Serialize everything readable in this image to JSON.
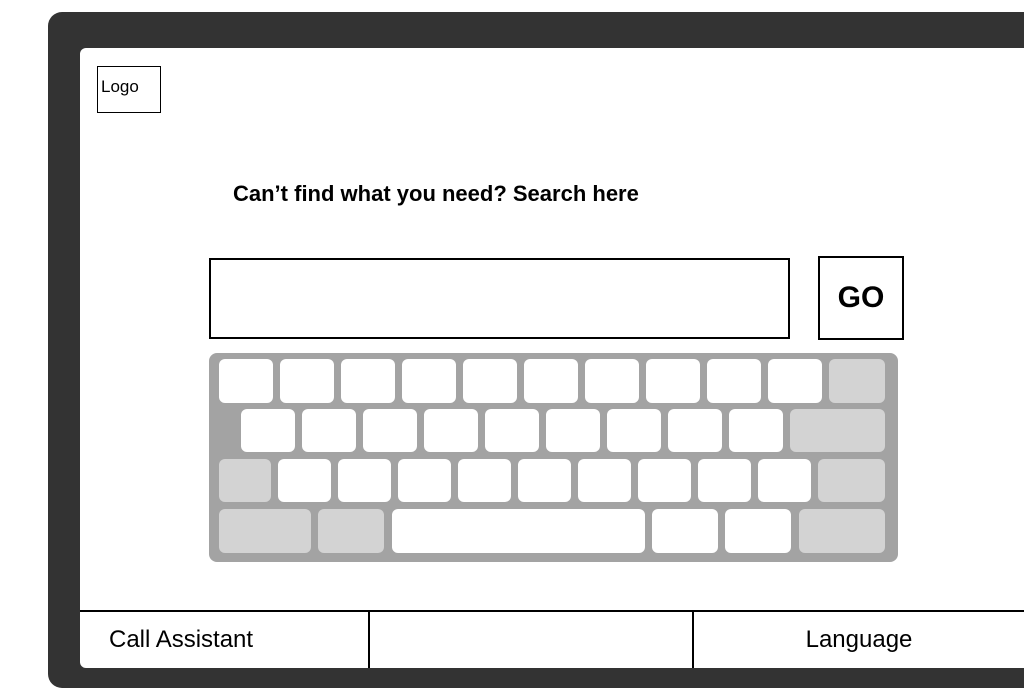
{
  "logo": {
    "label": "Logo"
  },
  "search": {
    "heading": "Can’t find what you need? Search here",
    "input_value": "",
    "placeholder": "",
    "go_label": "GO"
  },
  "keyboard": {
    "rows": [
      {
        "keys": [
          "key",
          "key",
          "key",
          "key",
          "key",
          "key",
          "key",
          "key",
          "key",
          "key",
          "mod"
        ]
      },
      {
        "keys": [
          "key",
          "key",
          "key",
          "key",
          "key",
          "key",
          "key",
          "key",
          "key",
          "mod"
        ]
      },
      {
        "keys": [
          "mod",
          "key",
          "key",
          "key",
          "key",
          "key",
          "key",
          "key",
          "key",
          "key",
          "mod"
        ]
      },
      {
        "keys": [
          "mod",
          "mod",
          "space",
          "key",
          "key",
          "mod"
        ]
      }
    ]
  },
  "bottom_bar": {
    "call_assistant": "Call Assistant",
    "middle": "",
    "language": "Language"
  },
  "colors": {
    "device_frame": "#333333",
    "keyboard_base": "#a3a3a3",
    "key_light": "#ffffff",
    "key_modifier": "#d3d3d3"
  }
}
